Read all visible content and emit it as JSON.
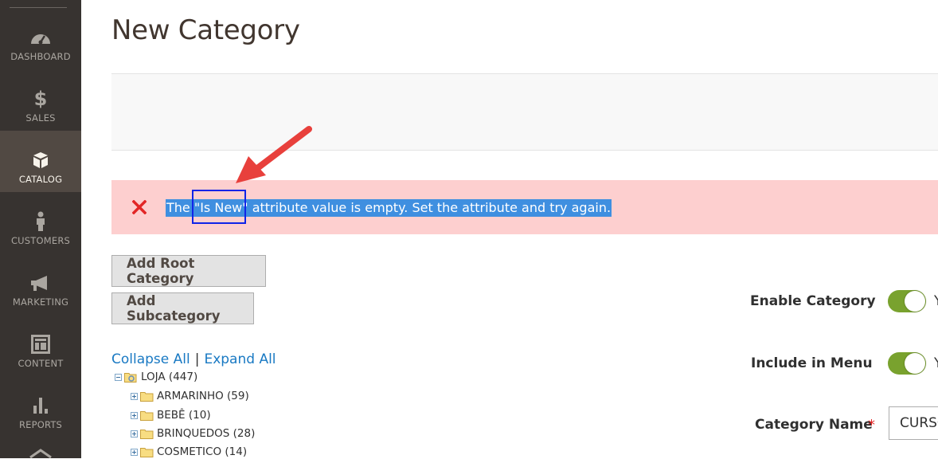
{
  "sidebar": {
    "items": [
      {
        "label": "DASHBOARD",
        "icon": "dashboard-icon",
        "active": false
      },
      {
        "label": "SALES",
        "icon": "dollar-icon",
        "active": false
      },
      {
        "label": "CATALOG",
        "icon": "box-icon",
        "active": true
      },
      {
        "label": "CUSTOMERS",
        "icon": "person-icon",
        "active": false
      },
      {
        "label": "MARKETING",
        "icon": "megaphone-icon",
        "active": false
      },
      {
        "label": "CONTENT",
        "icon": "layout-icon",
        "active": false
      },
      {
        "label": "REPORTS",
        "icon": "bar-chart-icon",
        "active": false
      }
    ]
  },
  "page": {
    "title": "New Category"
  },
  "error": {
    "message": "The \"Is New\" attribute value is empty. Set the attribute and try again.",
    "color": "#e22626"
  },
  "buttons": {
    "add_root": "Add Root Category",
    "add_sub": "Add Subcategory"
  },
  "tree": {
    "collapse_all": "Collapse All",
    "separator": "|",
    "expand_all": "Expand All",
    "root": "LOJA (447)",
    "children": [
      "ARMARINHO (59)",
      "BEBÊ (10)",
      "BRINQUEDOS (28)",
      "COSMETICO (14)"
    ]
  },
  "form": {
    "enable_category": {
      "label": "Enable Category",
      "tail": "Y"
    },
    "include_in_menu": {
      "label": "Include in Menu",
      "tail": "Y"
    },
    "category_name": {
      "label": "Category Name",
      "required": "*",
      "value": "CURSO"
    }
  },
  "colors": {
    "toggle_on": "#79a22e",
    "link": "#1979c3",
    "sidebar_bg": "#373330",
    "highlight": "#3f8fe0"
  }
}
